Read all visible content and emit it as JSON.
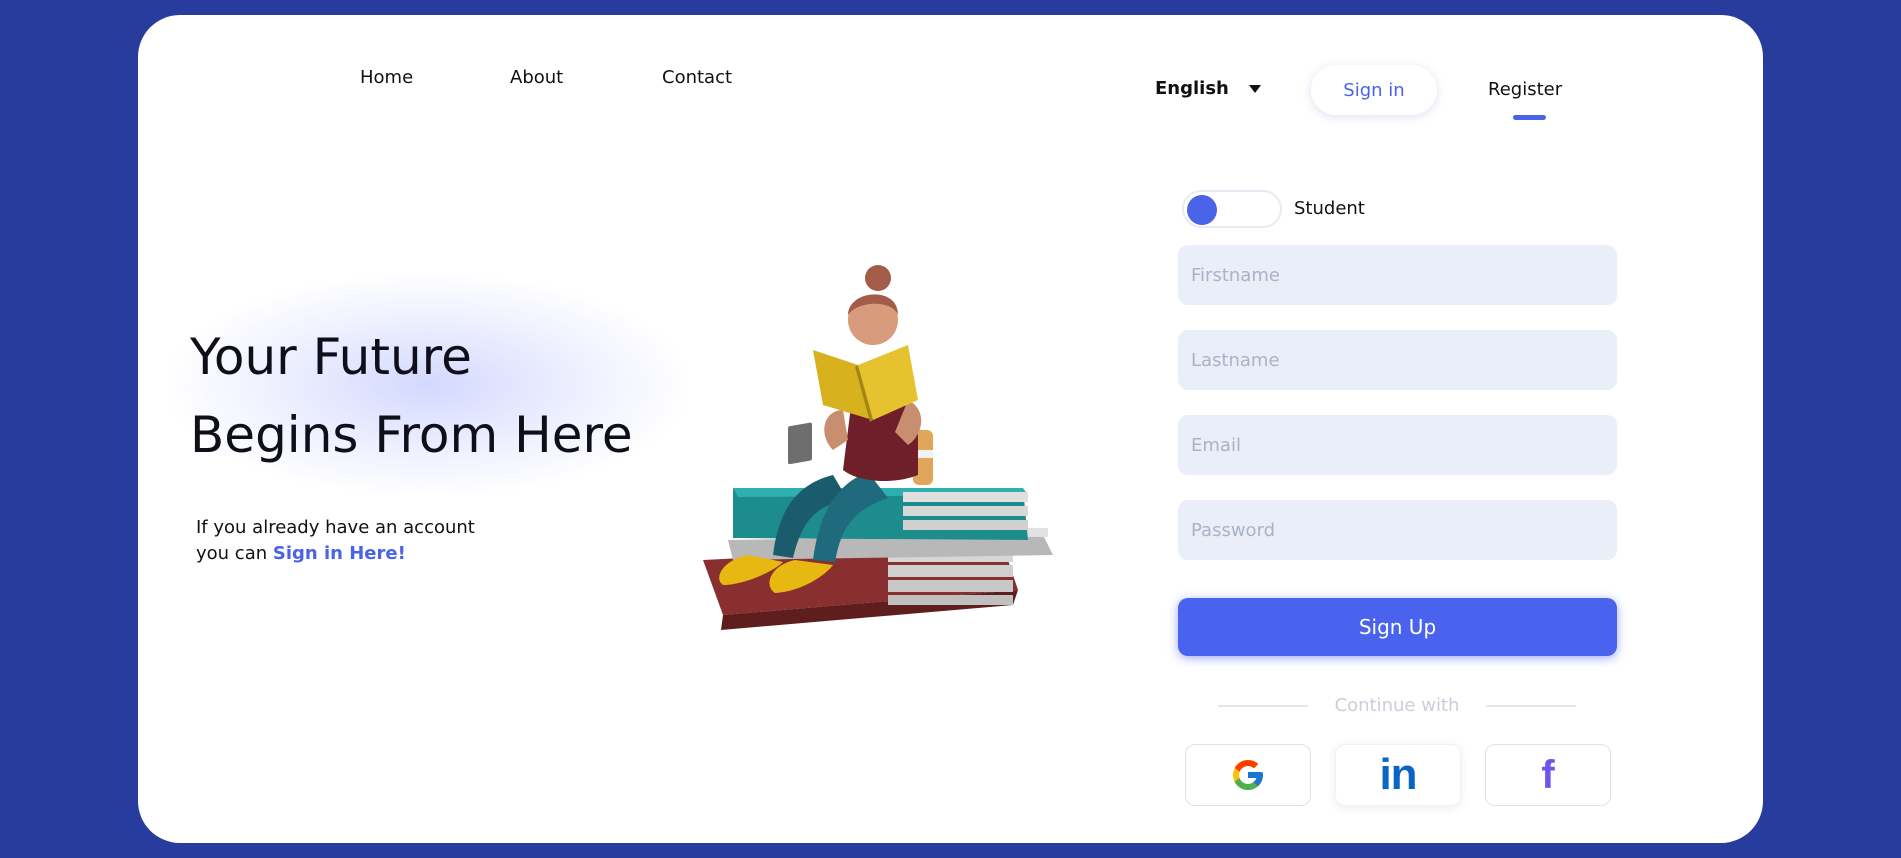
{
  "nav": {
    "home": "Home",
    "about": "About",
    "contact": "Contact",
    "language": "English",
    "sign_in": "Sign in",
    "register": "Register"
  },
  "hero": {
    "title_line1": "Your Future",
    "title_line2": "Begins From Here",
    "sub_line1": "If you already have an account",
    "sub_line2_prefix": "you can ",
    "sub_link": "Sign in Here!"
  },
  "form": {
    "toggle_label": "Student",
    "firstname_placeholder": "Firstname",
    "lastname_placeholder": "Lastname",
    "email_placeholder": "Email",
    "password_placeholder": "Password",
    "submit_label": "Sign Up",
    "continue_with": "Continue with"
  },
  "social": {
    "google_icon": "google-icon",
    "linkedin_icon": "linkedin-icon",
    "facebook_icon": "facebook-icon"
  },
  "colors": {
    "background": "#283c9e",
    "accent": "#4a63ee",
    "field_bg": "#e9eef8"
  }
}
